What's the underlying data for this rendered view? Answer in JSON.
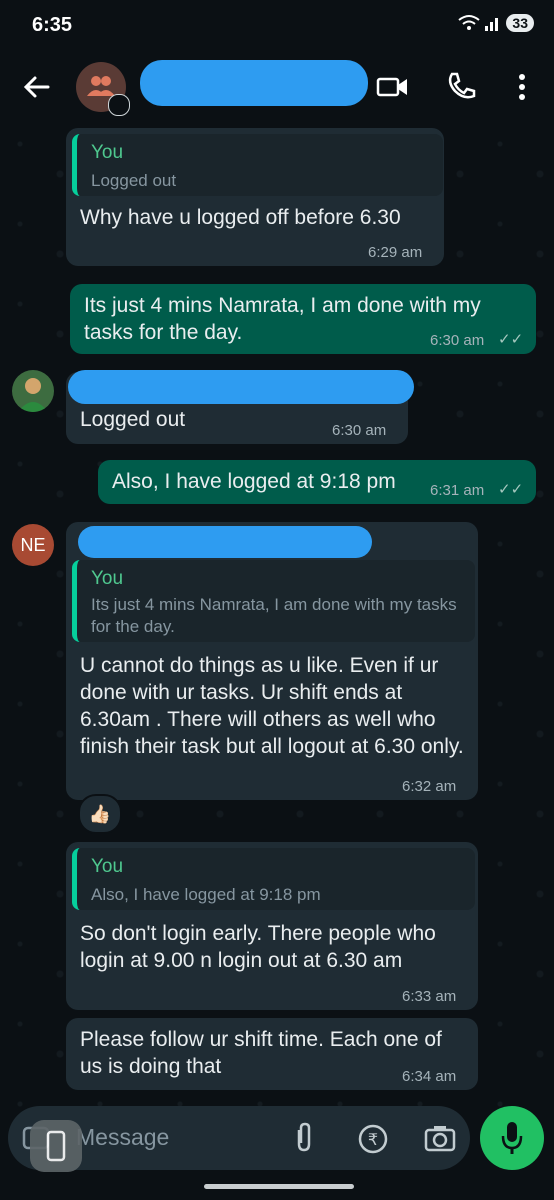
{
  "status_bar": {
    "time": "6:35",
    "battery": "33"
  },
  "header": {
    "title_redacted": true
  },
  "messages": [
    {
      "id": "m1",
      "direction": "in",
      "quote_name": "You",
      "quote_text": "Logged out",
      "text": "Why have u logged off before 6.30",
      "time": "6:29 am"
    },
    {
      "id": "m2",
      "direction": "out",
      "text": "Its just 4 mins Namrata, I am done with my tasks for the day.",
      "time": "6:30 am",
      "ticks": "✓✓"
    },
    {
      "id": "m3",
      "direction": "in",
      "sender_redacted": true,
      "text": "Logged out",
      "time": "6:30 am"
    },
    {
      "id": "m4",
      "direction": "out",
      "text": "Also, I have logged at 9:18 pm",
      "time": "6:31 am",
      "ticks": "✓✓"
    },
    {
      "id": "m5",
      "direction": "in",
      "sender_initials": "NE",
      "quote_name": "You",
      "quote_text": "Its just 4 mins Namrata, I am done with my tasks for the day.",
      "text": "U cannot do things as u like. Even if ur done with ur tasks. Ur shift ends at 6.30am . There will others as well who finish their task but all logout at 6.30 only.",
      "time": "6:32 am",
      "reaction": "👍🏻"
    },
    {
      "id": "m6",
      "direction": "in",
      "quote_name": "You",
      "quote_text": "Also, I have logged at 9:18 pm",
      "text": "So don't login early. There people who login at 9.00 n login out at 6.30 am",
      "time": "6:33 am"
    },
    {
      "id": "m7",
      "direction": "in",
      "text": "Please follow ur shift time. Each one of us is doing that",
      "time": "6:34 am"
    }
  ],
  "composer": {
    "placeholder": "Message"
  },
  "icons": [
    "back-arrow-icon",
    "group-avatar-icon",
    "video-call-icon",
    "voice-call-icon",
    "more-options-icon",
    "emoji-icon",
    "attach-icon",
    "rupee-payment-icon",
    "camera-icon",
    "mic-icon"
  ],
  "colors": {
    "incoming_bubble": "#1f2c34",
    "outgoing_bubble": "#005c4b",
    "accent": "#21c063",
    "redaction": "#2e9cf1"
  }
}
